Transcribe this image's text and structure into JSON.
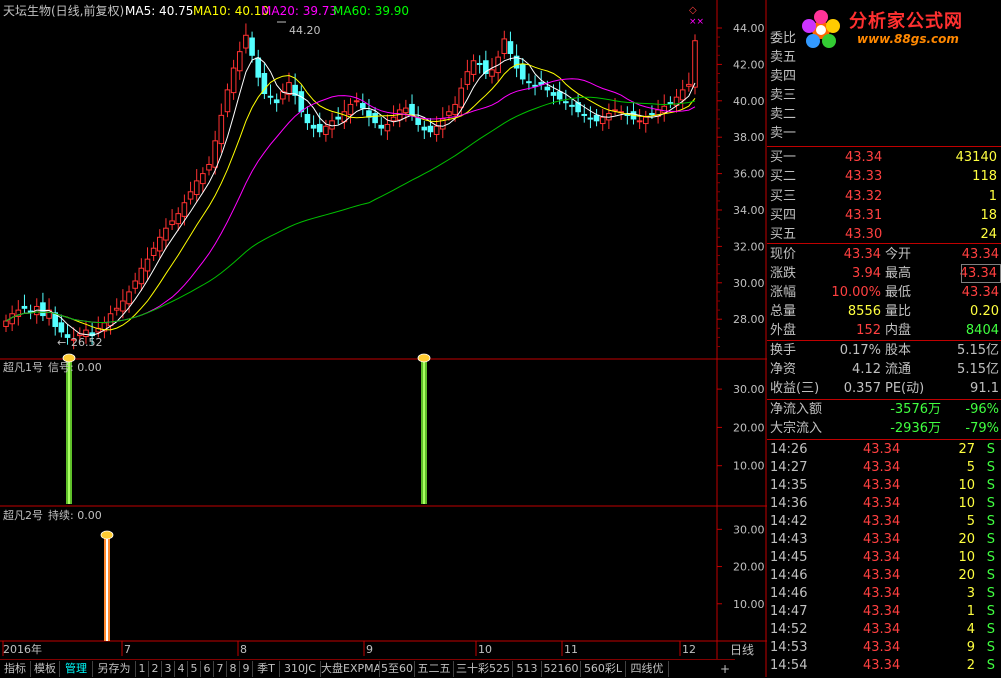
{
  "header": {
    "stock": "天坛生物(日线,前复权)",
    "ma5": "MA5: 40.75",
    "ma10": "MA10: 40.10",
    "ma20": "MA20: 39.73",
    "ma60": "MA60: 39.90"
  },
  "main_chart": {
    "y_ticks": [
      "44.00",
      "42.00",
      "40.00",
      "38.00",
      "36.00",
      "34.00",
      "32.00",
      "30.00",
      "28.00"
    ],
    "high_label": "44.20",
    "low_label": "26.52",
    "x_labels": [
      "2016年",
      "7",
      "8",
      "9",
      "10",
      "11",
      "12"
    ]
  },
  "indicator1": {
    "title": "超凡1号",
    "signal_label": "信号: 0.00",
    "y_ticks": [
      "30.00",
      "20.00",
      "10.00"
    ]
  },
  "indicator2": {
    "title": "超凡2号",
    "signal_label": "持续: 0.00",
    "y_ticks": [
      "30.00",
      "20.00",
      "10.00"
    ]
  },
  "colors": {
    "up": "#ff3232",
    "down": "#54ffff",
    "ma5": "#ffffff",
    "ma10": "#ffff00",
    "ma20": "#ff00ff",
    "ma60": "#00c000",
    "grid": "#800000"
  },
  "quote": {
    "weibi": "委比",
    "sell": [
      {
        "label": "卖五"
      },
      {
        "label": "卖四"
      },
      {
        "label": "卖三"
      },
      {
        "label": "卖二"
      },
      {
        "label": "卖一"
      }
    ],
    "buy": [
      {
        "label": "买一",
        "price": "43.34",
        "vol": "43140"
      },
      {
        "label": "买二",
        "price": "43.33",
        "vol": "118"
      },
      {
        "label": "买三",
        "price": "43.32",
        "vol": "1"
      },
      {
        "label": "买四",
        "price": "43.31",
        "vol": "18"
      },
      {
        "label": "买五",
        "price": "43.30",
        "vol": "24"
      }
    ],
    "stats": [
      {
        "l1": "现价",
        "v1": "43.34",
        "l2": "今开",
        "v2": "43.34"
      },
      {
        "l1": "涨跌",
        "v1": "3.94",
        "l2": "最高",
        "v2": "43.34"
      },
      {
        "l1": "涨幅",
        "v1": "10.00%",
        "l2": "最低",
        "v2": "43.34"
      },
      {
        "l1": "总量",
        "v1": "8556",
        "l2": "量比",
        "v2": "0.20"
      },
      {
        "l1": "外盘",
        "v1": "152",
        "l2": "内盘",
        "v2": "8404"
      }
    ],
    "stats2": [
      {
        "l1": "换手",
        "v1": "0.17%",
        "l2": "股本",
        "v2": "5.15亿"
      },
      {
        "l1": "净资",
        "v1": "4.12",
        "l2": "流通",
        "v2": "5.15亿"
      },
      {
        "l1": "收益(三)",
        "v1": "0.357",
        "l2": "PE(动)",
        "v2": "91.1"
      }
    ],
    "flows": [
      {
        "label": "净流入额",
        "value": "-3576万",
        "pct": "-96%"
      },
      {
        "label": "大宗流入",
        "value": "-2936万",
        "pct": "-79%"
      }
    ],
    "ticks": [
      {
        "time": "14:26",
        "price": "43.34",
        "vol": "27",
        "side": "S"
      },
      {
        "time": "14:27",
        "price": "43.34",
        "vol": "5",
        "side": "S"
      },
      {
        "time": "14:35",
        "price": "43.34",
        "vol": "10",
        "side": "S"
      },
      {
        "time": "14:36",
        "price": "43.34",
        "vol": "10",
        "side": "S"
      },
      {
        "time": "14:42",
        "price": "43.34",
        "vol": "5",
        "side": "S"
      },
      {
        "time": "14:43",
        "price": "43.34",
        "vol": "20",
        "side": "S"
      },
      {
        "time": "14:45",
        "price": "43.34",
        "vol": "10",
        "side": "S"
      },
      {
        "time": "14:46",
        "price": "43.34",
        "vol": "20",
        "side": "S"
      },
      {
        "time": "14:46",
        "price": "43.34",
        "vol": "3",
        "side": "S"
      },
      {
        "time": "14:47",
        "price": "43.34",
        "vol": "1",
        "side": "S"
      },
      {
        "time": "14:52",
        "price": "43.34",
        "vol": "4",
        "side": "S"
      },
      {
        "time": "14:53",
        "price": "43.34",
        "vol": "9",
        "side": "S"
      },
      {
        "time": "14:54",
        "price": "43.34",
        "vol": "2",
        "side": "S"
      }
    ]
  },
  "tabs": [
    "指标",
    "模板",
    "管理",
    "另存为",
    "1",
    "2",
    "3",
    "4",
    "5",
    "6",
    "7",
    "8",
    "9",
    "季T",
    "310JC",
    "大盘EXPMA",
    "5至60",
    "五二五",
    "三十彩525",
    "513",
    "52160",
    "560彩L",
    "四线优"
  ],
  "tab_active": "管理",
  "bottom_right": {
    "plus": "+",
    "period": "日线"
  },
  "logo": {
    "text": "分析家公式网",
    "url": "www.88gs.com"
  }
}
